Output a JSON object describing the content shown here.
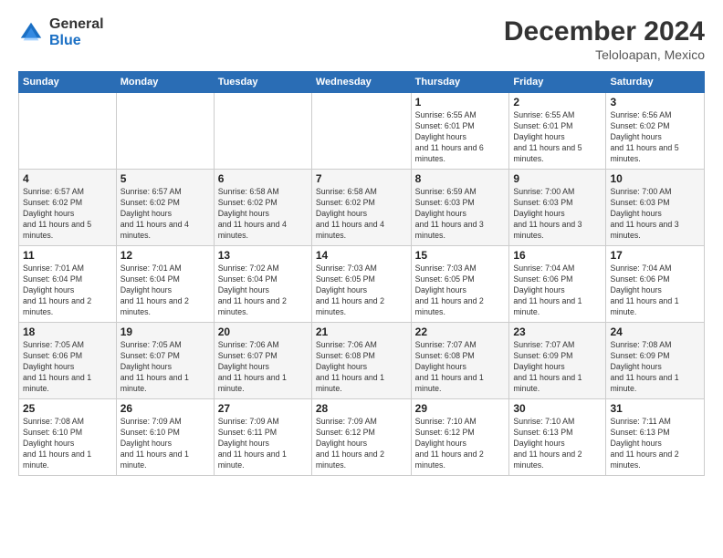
{
  "header": {
    "logo_general": "General",
    "logo_blue": "Blue",
    "title": "December 2024",
    "location": "Teloloapan, Mexico"
  },
  "calendar": {
    "days_of_week": [
      "Sunday",
      "Monday",
      "Tuesday",
      "Wednesday",
      "Thursday",
      "Friday",
      "Saturday"
    ],
    "weeks": [
      [
        null,
        null,
        null,
        null,
        {
          "day": 1,
          "sunrise": "6:55 AM",
          "sunset": "6:01 PM",
          "daylight": "11 hours and 6 minutes."
        },
        {
          "day": 2,
          "sunrise": "6:55 AM",
          "sunset": "6:01 PM",
          "daylight": "11 hours and 5 minutes."
        },
        {
          "day": 3,
          "sunrise": "6:56 AM",
          "sunset": "6:02 PM",
          "daylight": "11 hours and 5 minutes."
        }
      ],
      [
        {
          "day": 4,
          "sunrise": "6:57 AM",
          "sunset": "6:02 PM",
          "daylight": "11 hours and 5 minutes."
        },
        {
          "day": 5,
          "sunrise": "6:57 AM",
          "sunset": "6:02 PM",
          "daylight": "11 hours and 4 minutes."
        },
        {
          "day": 6,
          "sunrise": "6:58 AM",
          "sunset": "6:02 PM",
          "daylight": "11 hours and 4 minutes."
        },
        {
          "day": 7,
          "sunrise": "6:58 AM",
          "sunset": "6:02 PM",
          "daylight": "11 hours and 4 minutes."
        },
        {
          "day": 8,
          "sunrise": "6:59 AM",
          "sunset": "6:03 PM",
          "daylight": "11 hours and 3 minutes."
        },
        {
          "day": 9,
          "sunrise": "7:00 AM",
          "sunset": "6:03 PM",
          "daylight": "11 hours and 3 minutes."
        },
        {
          "day": 10,
          "sunrise": "7:00 AM",
          "sunset": "6:03 PM",
          "daylight": "11 hours and 3 minutes."
        }
      ],
      [
        {
          "day": 11,
          "sunrise": "7:01 AM",
          "sunset": "6:04 PM",
          "daylight": "11 hours and 2 minutes."
        },
        {
          "day": 12,
          "sunrise": "7:01 AM",
          "sunset": "6:04 PM",
          "daylight": "11 hours and 2 minutes."
        },
        {
          "day": 13,
          "sunrise": "7:02 AM",
          "sunset": "6:04 PM",
          "daylight": "11 hours and 2 minutes."
        },
        {
          "day": 14,
          "sunrise": "7:03 AM",
          "sunset": "6:05 PM",
          "daylight": "11 hours and 2 minutes."
        },
        {
          "day": 15,
          "sunrise": "7:03 AM",
          "sunset": "6:05 PM",
          "daylight": "11 hours and 2 minutes."
        },
        {
          "day": 16,
          "sunrise": "7:04 AM",
          "sunset": "6:06 PM",
          "daylight": "11 hours and 1 minute."
        },
        {
          "day": 17,
          "sunrise": "7:04 AM",
          "sunset": "6:06 PM",
          "daylight": "11 hours and 1 minute."
        }
      ],
      [
        {
          "day": 18,
          "sunrise": "7:05 AM",
          "sunset": "6:06 PM",
          "daylight": "11 hours and 1 minute."
        },
        {
          "day": 19,
          "sunrise": "7:05 AM",
          "sunset": "6:07 PM",
          "daylight": "11 hours and 1 minute."
        },
        {
          "day": 20,
          "sunrise": "7:06 AM",
          "sunset": "6:07 PM",
          "daylight": "11 hours and 1 minute."
        },
        {
          "day": 21,
          "sunrise": "7:06 AM",
          "sunset": "6:08 PM",
          "daylight": "11 hours and 1 minute."
        },
        {
          "day": 22,
          "sunrise": "7:07 AM",
          "sunset": "6:08 PM",
          "daylight": "11 hours and 1 minute."
        },
        {
          "day": 23,
          "sunrise": "7:07 AM",
          "sunset": "6:09 PM",
          "daylight": "11 hours and 1 minute."
        },
        {
          "day": 24,
          "sunrise": "7:08 AM",
          "sunset": "6:09 PM",
          "daylight": "11 hours and 1 minute."
        }
      ],
      [
        {
          "day": 25,
          "sunrise": "7:08 AM",
          "sunset": "6:10 PM",
          "daylight": "11 hours and 1 minute."
        },
        {
          "day": 26,
          "sunrise": "7:09 AM",
          "sunset": "6:10 PM",
          "daylight": "11 hours and 1 minute."
        },
        {
          "day": 27,
          "sunrise": "7:09 AM",
          "sunset": "6:11 PM",
          "daylight": "11 hours and 1 minute."
        },
        {
          "day": 28,
          "sunrise": "7:09 AM",
          "sunset": "6:12 PM",
          "daylight": "11 hours and 2 minutes."
        },
        {
          "day": 29,
          "sunrise": "7:10 AM",
          "sunset": "6:12 PM",
          "daylight": "11 hours and 2 minutes."
        },
        {
          "day": 30,
          "sunrise": "7:10 AM",
          "sunset": "6:13 PM",
          "daylight": "11 hours and 2 minutes."
        },
        {
          "day": 31,
          "sunrise": "7:11 AM",
          "sunset": "6:13 PM",
          "daylight": "11 hours and 2 minutes."
        }
      ]
    ]
  }
}
